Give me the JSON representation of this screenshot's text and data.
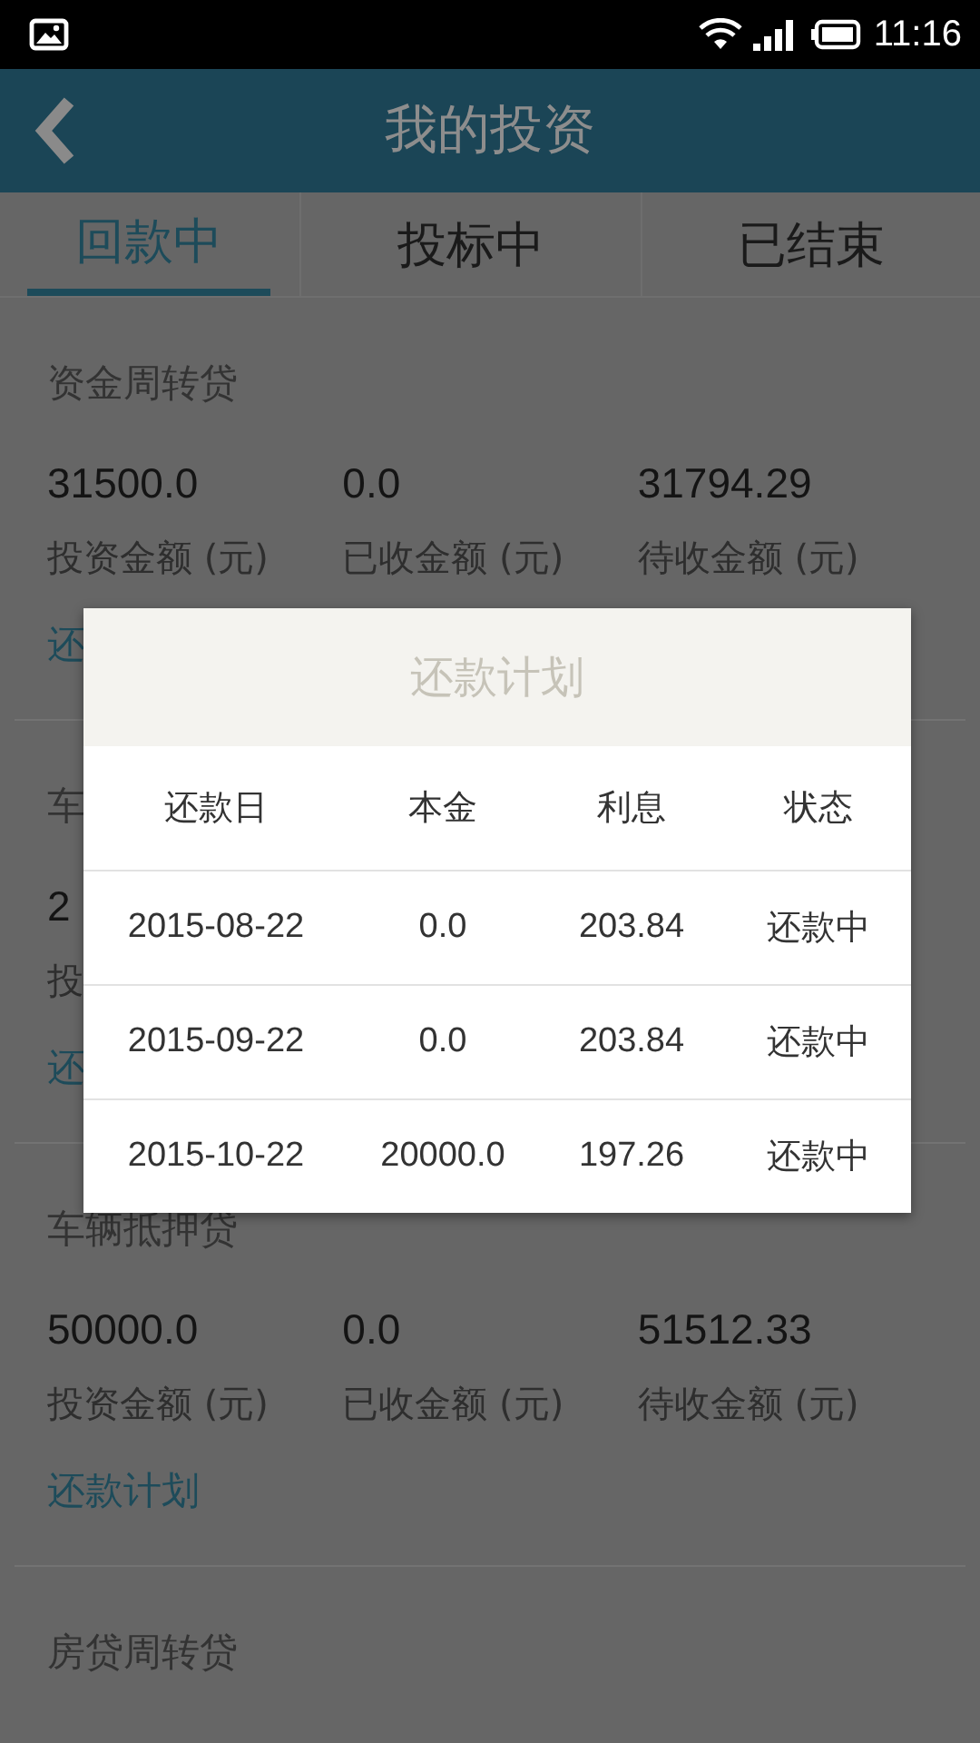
{
  "status_bar": {
    "time": "11:16"
  },
  "app_bar": {
    "title": "我的投资"
  },
  "tabs": [
    {
      "label": "回款中",
      "selected": true
    },
    {
      "label": "投标中",
      "selected": false
    },
    {
      "label": "已结束",
      "selected": false
    }
  ],
  "investments": [
    {
      "title": "资金周转贷",
      "stats": [
        {
          "amount": "31500.0",
          "label": "投资金额 (元)"
        },
        {
          "amount": "0.0",
          "label": "已收金额 (元)"
        },
        {
          "amount": "31794.29",
          "label": "待收金额 (元)"
        }
      ],
      "link": "还"
    },
    {
      "title": "车",
      "stats": [
        {
          "amount": "2",
          "label": "投"
        }
      ],
      "link": "还"
    },
    {
      "title": "车辆抵押贷",
      "stats": [
        {
          "amount": "50000.0",
          "label": "投资金额 (元)"
        },
        {
          "amount": "0.0",
          "label": "已收金额 (元)"
        },
        {
          "amount": "51512.33",
          "label": "待收金额 (元)"
        }
      ],
      "link": "还款计划"
    },
    {
      "title": "房贷周转贷"
    }
  ],
  "dialog": {
    "title": "还款计划",
    "columns": [
      "还款日",
      "本金",
      "利息",
      "状态"
    ],
    "rows": [
      [
        "2015-08-22",
        "0.0",
        "203.84",
        "还款中"
      ],
      [
        "2015-09-22",
        "0.0",
        "203.84",
        "还款中"
      ],
      [
        "2015-10-22",
        "20000.0",
        "197.26",
        "还款中"
      ]
    ]
  }
}
